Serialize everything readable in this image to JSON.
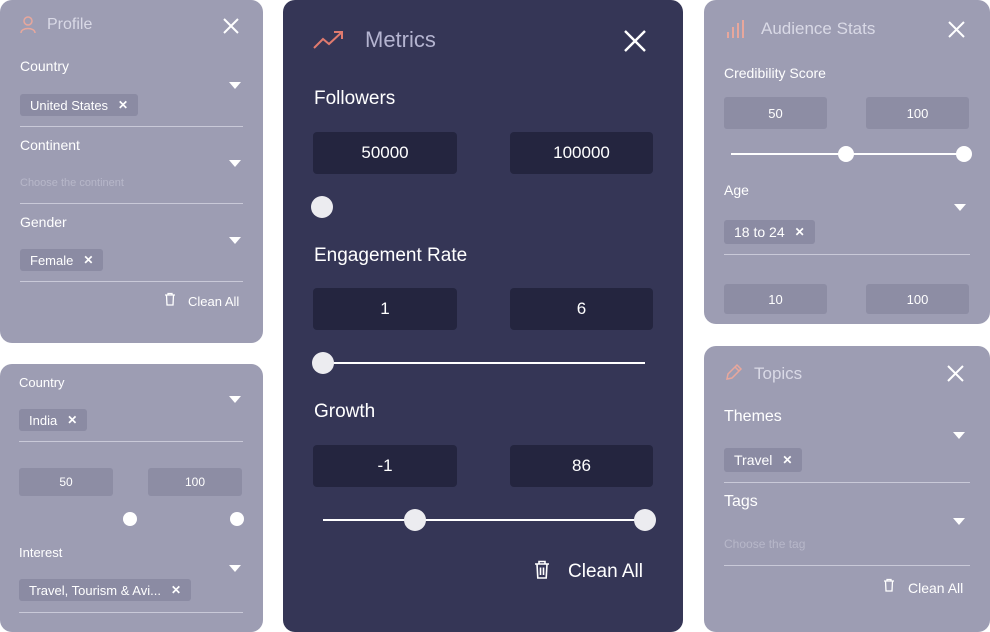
{
  "profile": {
    "title": "Profile",
    "country_label": "Country",
    "country_chip": "United States",
    "continent_label": "Continent",
    "continent_placeholder": "Choose the continent",
    "gender_label": "Gender",
    "gender_chip": "Female",
    "clean_all": "Clean All"
  },
  "filters": {
    "country_label": "Country",
    "country_chip": "India",
    "min": "50",
    "max": "100",
    "interest_label": "Interest",
    "interest_chip": "Travel, Tourism & Avi..."
  },
  "metrics": {
    "title": "Metrics",
    "followers_label": "Followers",
    "followers_min": "50000",
    "followers_max": "100000",
    "engagement_label": "Engagement Rate",
    "engagement_min": "1",
    "engagement_max": "6",
    "growth_label": "Growth",
    "growth_min": "-1",
    "growth_max": "86",
    "clean_all": "Clean All"
  },
  "audience": {
    "title": "Audience Stats",
    "cred_label": "Credibility Score",
    "cred_min": "50",
    "cred_max": "100",
    "age_label": "Age",
    "age_chip": "18 to 24",
    "range_min": "10",
    "range_max": "100"
  },
  "topics": {
    "title": "Topics",
    "themes_label": "Themes",
    "themes_chip": "Travel",
    "tags_label": "Tags",
    "tags_placeholder": "Choose the tag",
    "clean_all": "Clean All"
  },
  "colors": {
    "accent": "#e07a6e",
    "dark_panel": "#353656",
    "dim_panel": "#9d9db3"
  }
}
